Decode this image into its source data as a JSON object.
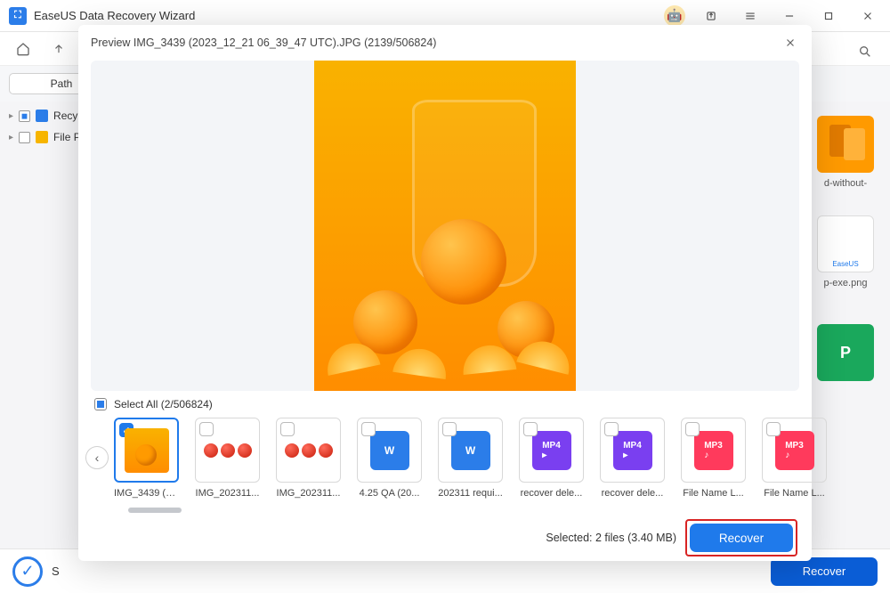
{
  "app": {
    "title": "EaseUS Data Recovery Wizard"
  },
  "path_button": "Path",
  "tree": {
    "item1": "Recy",
    "item2": "File P"
  },
  "bg_items": {
    "i1": "d-without-",
    "i2": "p-exe.png"
  },
  "modal": {
    "title": "Preview IMG_3439 (2023_12_21 06_39_47 UTC).JPG (2139/506824)",
    "select_all": "Select All (2/506824)",
    "selected_info": "Selected: 2 files (3.40 MB)",
    "recover": "Recover"
  },
  "thumbs": [
    {
      "name": "IMG_3439 (2...",
      "kind": "orange",
      "checked": true,
      "selected": true
    },
    {
      "name": "IMG_202311...",
      "kind": "tomato",
      "checked": false
    },
    {
      "name": "IMG_202311...",
      "kind": "tomato",
      "checked": false
    },
    {
      "name": "4.25 QA (20...",
      "kind": "w",
      "checked": false
    },
    {
      "name": "202311 requi...",
      "kind": "w",
      "checked": false
    },
    {
      "name": "recover dele...",
      "kind": "mp4",
      "checked": false
    },
    {
      "name": "recover dele...",
      "kind": "mp4",
      "checked": false
    },
    {
      "name": "File Name L...",
      "kind": "mp3",
      "checked": false
    },
    {
      "name": "File Name L...",
      "kind": "mp3",
      "checked": false
    }
  ],
  "bottom_recover": "Recover"
}
